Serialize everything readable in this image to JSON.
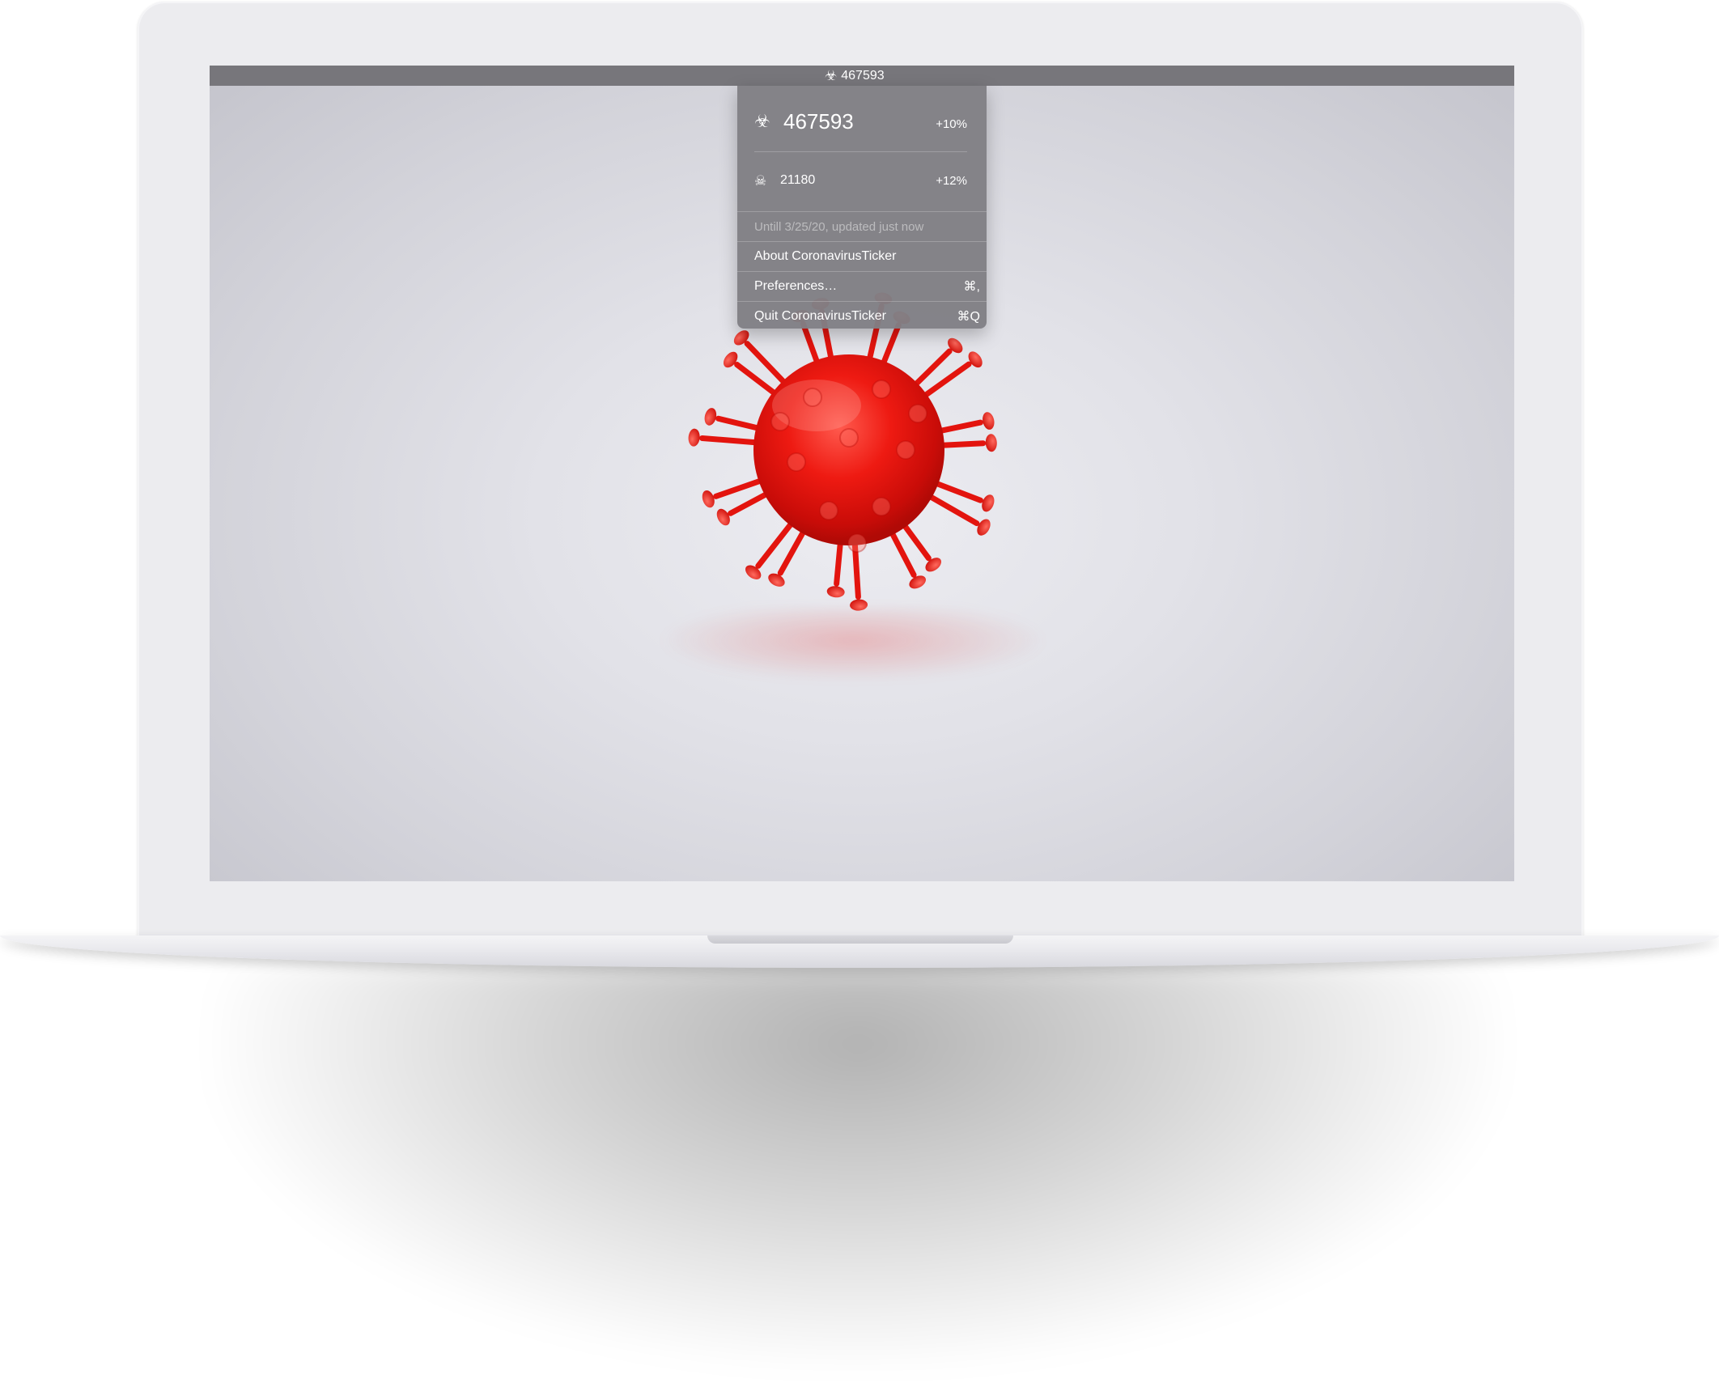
{
  "menubar": {
    "status_icon": "biohazard-icon",
    "status_value": "467593"
  },
  "menu": {
    "cases": {
      "icon": "biohazard-icon",
      "value": "467593",
      "change": "+10%"
    },
    "deaths": {
      "icon": "skull-icon",
      "value": "21180",
      "change": "+12%"
    },
    "update_note": "Untill 3/25/20, updated just now",
    "items": [
      {
        "label": "About CoronavirusTicker",
        "shortcut": ""
      },
      {
        "label": "Preferences…",
        "shortcut": "⌘,"
      },
      {
        "label": "Quit CoronavirusTicker",
        "shortcut": "⌘Q"
      }
    ]
  },
  "colors": {
    "menubar": "#77767b",
    "menu_background": "#807f84",
    "virus_red": "#e8140f"
  }
}
